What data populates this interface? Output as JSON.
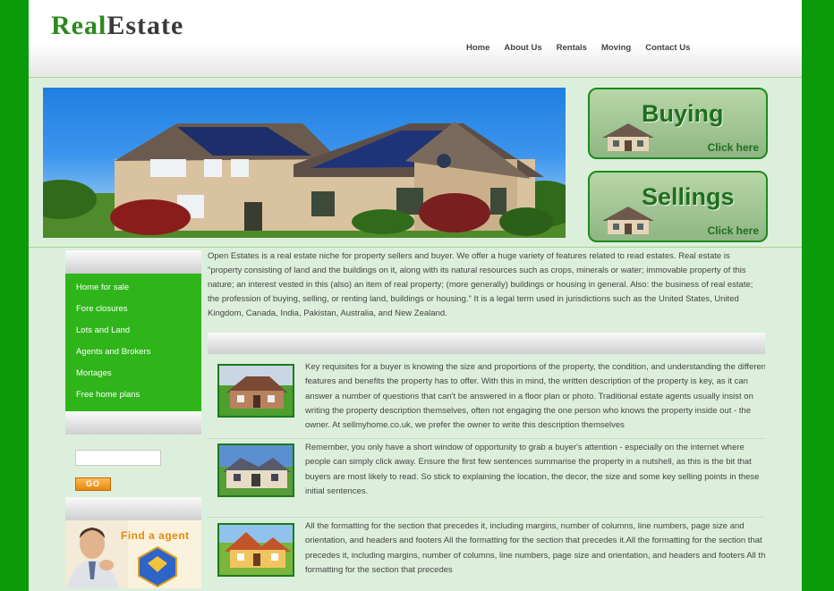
{
  "logo": {
    "real": "Real",
    "estate": "Estate"
  },
  "nav": [
    "Home",
    "About Us",
    "Rentals",
    "Moving",
    "Contact Us"
  ],
  "promos": [
    {
      "title": "Buying",
      "click": "Click here"
    },
    {
      "title": "Sellings",
      "click": "Click here"
    }
  ],
  "sidebar": {
    "menu": [
      "Home for sale",
      "Fore closures",
      "Lots and Land",
      "Agents and Brokers",
      "Mortages",
      "Free home plans"
    ],
    "search": {
      "value": "",
      "button": "GO"
    },
    "find_agent": "Find a agent"
  },
  "intro": "Open Estates is a real estate niche for property sellers and buyer. We offer a huge variety of features related to read estates. Real estate is \"property consisting of land and the buildings on it, along with its natural resources such as crops, minerals or water; immovable property of this nature; an interest vested in this (also) an item of real property; (more generally) buildings or housing in general. Also: the business of real estate; the profession of buying, selling, or renting land, buildings or housing.\" It is a legal term used in jurisdictions such as the United States, United Kingdom, Canada, India, Pakistan, Australia, and New Zealand.",
  "articles": [
    "Key requisites for a buyer is knowing the size and proportions of the property, the condition, and understanding the different features and benefits the property has to offer. With this in mind, the written description of the property is key, as it can answer a number of questions that can't be answered in a floor plan or photo. Traditional estate agents usually insist on writing the property description themselves, often not engaging the one person who knows the property inside out - the owner. At sellmyhome.co.uk, we prefer the owner to write this description themselves",
    "Remember, you only have a short window of opportunity to grab a buyer's attention - especially on the internet where people can simply click away. Ensure the first few sentences summarise the property in a nutshell, as this is the bit that buyers are most likely to read. So stick to explaining the location, the decor, the size and some key selling points in these initial sentences.",
    "All the formatting for the section that precedes it, including margins, number of columns, line numbers, page size and orientation, and headers and footers All the formatting for the section that precedes it.All the formatting for the section that precedes it, including margins, number of columns, line numbers, page size and orientation, and headers and footers All the formatting for the section that precedes"
  ]
}
